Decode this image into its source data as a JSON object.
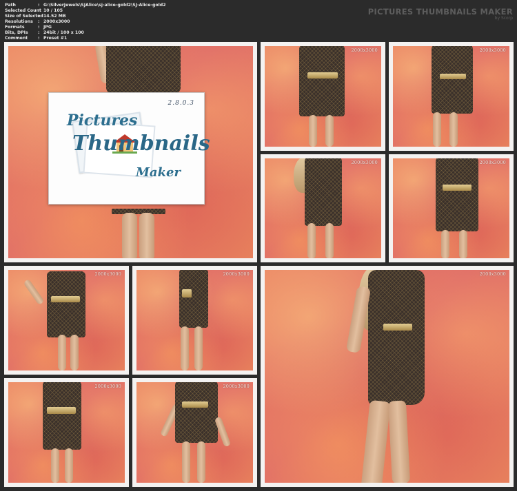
{
  "header": {
    "info": [
      {
        "key": "Path",
        "value": "G:\\SilverJewels\\SJAlice\\sj-alice-gold2\\SJ-Alice-gold2"
      },
      {
        "key": "Selected Count",
        "value": "10 / 105"
      },
      {
        "key": "Size of Selected",
        "value": "14.52 MB"
      },
      {
        "key": "Resolutions",
        "value": "2000x3000"
      },
      {
        "key": "Formats",
        "value": "JPG"
      },
      {
        "key": "Bits, DPIs",
        "value": "24bit / 100 x 100"
      },
      {
        "key": "Comment",
        "value": "Preset #1"
      }
    ],
    "separator": ":",
    "brand_title": "PICTURES THUMBNAILS MAKER",
    "brand_sub": "by Scorp"
  },
  "logo": {
    "version": "2.8.0.3",
    "line1": "Pictures",
    "line2": "Thumbnails",
    "line3": "Maker"
  },
  "thumbnails": [
    {
      "resolution": "2000x3000"
    },
    {
      "resolution": "2000x3000"
    },
    {
      "resolution": "2000x3000"
    },
    {
      "resolution": "2000x3000"
    },
    {
      "resolution": "2000x3000"
    },
    {
      "resolution": "2000x3000"
    },
    {
      "resolution": "2000x3000"
    },
    {
      "resolution": "2000x3000"
    },
    {
      "resolution": "2000x3000"
    }
  ],
  "colors": {
    "background": "#2b2b2b",
    "frame": "#f4f2f1",
    "backdrop": "#e87d62",
    "dress": "#3a302a",
    "belt_gold": "#d8bd7c",
    "logo_blue": "#2a6787"
  }
}
